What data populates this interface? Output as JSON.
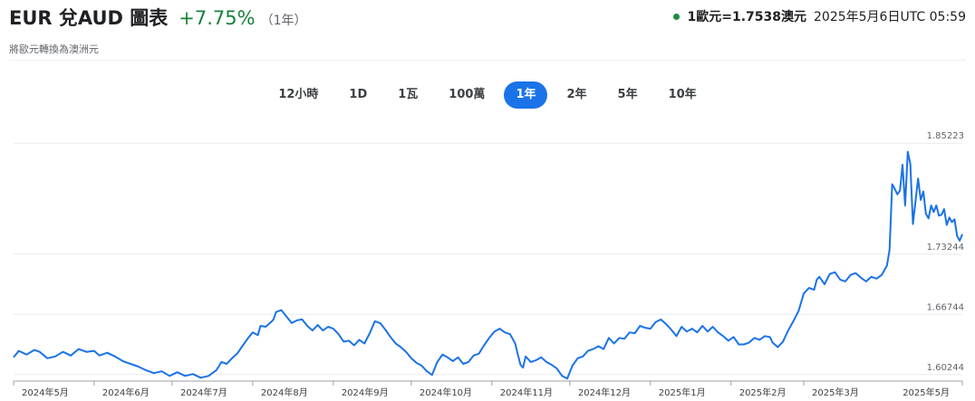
{
  "header": {
    "title": "EUR 兌AUD 圖表",
    "change": "+7.75%",
    "period": "（1年）",
    "subtitle": "將歐元轉換為澳洲元",
    "rate": "1歐元=1.7538澳元",
    "timestamp": "2025年5月6日UTC 05:59"
  },
  "tabs": [
    {
      "label": "12小時",
      "active": false
    },
    {
      "label": "1D",
      "active": false
    },
    {
      "label": "1瓦",
      "active": false
    },
    {
      "label": "100萬",
      "active": false
    },
    {
      "label": "1年",
      "active": true
    },
    {
      "label": "2年",
      "active": false
    },
    {
      "label": "5年",
      "active": false
    },
    {
      "label": "10年",
      "active": false
    }
  ],
  "colors": {
    "line": "#1a73e8",
    "up": "#188038",
    "active_tab": "#1a73e8"
  },
  "chart_data": {
    "type": "line",
    "ylim": [
      1.5954,
      1.8622
    ],
    "yticks": [
      {
        "value": 1.85223,
        "label": "1.85223"
      },
      {
        "value": 1.73244,
        "label": "1.73244"
      },
      {
        "value": 1.66744,
        "label": "1.66744"
      },
      {
        "value": 1.60244,
        "label": "1.60244"
      }
    ],
    "xticks": [
      "2024年5月",
      "2024年6月",
      "2024年7月",
      "2024年8月",
      "2024年9月",
      "2024年10月",
      "2024年11月",
      "2024年12月",
      "2025年1月",
      "2025年2月",
      "2025年3月",
      "2025年5月"
    ],
    "xlim": [
      0,
      365
    ],
    "xtick_positions": [
      0,
      31,
      61,
      92,
      123,
      153,
      184,
      214,
      245,
      276,
      304,
      365
    ],
    "grid": true,
    "series": [
      {
        "points": [
          [
            0,
            1.621
          ],
          [
            2,
            1.628
          ],
          [
            5,
            1.624
          ],
          [
            8,
            1.629
          ],
          [
            10,
            1.627
          ],
          [
            13,
            1.62
          ],
          [
            16,
            1.622
          ],
          [
            19,
            1.627
          ],
          [
            22,
            1.623
          ],
          [
            25,
            1.63
          ],
          [
            28,
            1.627
          ],
          [
            31,
            1.628
          ],
          [
            33,
            1.623
          ],
          [
            36,
            1.626
          ],
          [
            39,
            1.622
          ],
          [
            42,
            1.617
          ],
          [
            45,
            1.614
          ],
          [
            48,
            1.611
          ],
          [
            51,
            1.607
          ],
          [
            54,
            1.604
          ],
          [
            57,
            1.606
          ],
          [
            60,
            1.601
          ],
          [
            63,
            1.605
          ],
          [
            66,
            1.601
          ],
          [
            69,
            1.603
          ],
          [
            72,
            1.599
          ],
          [
            75,
            1.601
          ],
          [
            78,
            1.607
          ],
          [
            80,
            1.616
          ],
          [
            82,
            1.614
          ],
          [
            84,
            1.62
          ],
          [
            86,
            1.625
          ],
          [
            88,
            1.633
          ],
          [
            90,
            1.641
          ],
          [
            92,
            1.648
          ],
          [
            94,
            1.645
          ],
          [
            95,
            1.655
          ],
          [
            97,
            1.654
          ],
          [
            99,
            1.659
          ],
          [
            100,
            1.662
          ],
          [
            101,
            1.67
          ],
          [
            103,
            1.672
          ],
          [
            105,
            1.665
          ],
          [
            107,
            1.658
          ],
          [
            109,
            1.661
          ],
          [
            111,
            1.662
          ],
          [
            113,
            1.655
          ],
          [
            115,
            1.65
          ],
          [
            117,
            1.656
          ],
          [
            119,
            1.65
          ],
          [
            121,
            1.654
          ],
          [
            123,
            1.652
          ],
          [
            125,
            1.646
          ],
          [
            127,
            1.638
          ],
          [
            129,
            1.639
          ],
          [
            131,
            1.634
          ],
          [
            133,
            1.64
          ],
          [
            135,
            1.636
          ],
          [
            137,
            1.647
          ],
          [
            139,
            1.66
          ],
          [
            141,
            1.658
          ],
          [
            143,
            1.651
          ],
          [
            145,
            1.643
          ],
          [
            147,
            1.636
          ],
          [
            149,
            1.632
          ],
          [
            151,
            1.627
          ],
          [
            153,
            1.62
          ],
          [
            155,
            1.615
          ],
          [
            157,
            1.612
          ],
          [
            159,
            1.606
          ],
          [
            161,
            1.602
          ],
          [
            163,
            1.616
          ],
          [
            165,
            1.624
          ],
          [
            167,
            1.621
          ],
          [
            169,
            1.617
          ],
          [
            171,
            1.621
          ],
          [
            173,
            1.614
          ],
          [
            175,
            1.616
          ],
          [
            177,
            1.623
          ],
          [
            179,
            1.625
          ],
          [
            181,
            1.634
          ],
          [
            183,
            1.642
          ],
          [
            185,
            1.649
          ],
          [
            187,
            1.652
          ],
          [
            189,
            1.648
          ],
          [
            191,
            1.646
          ],
          [
            193,
            1.636
          ],
          [
            194,
            1.624
          ],
          [
            195,
            1.613
          ],
          [
            196,
            1.61
          ],
          [
            197,
            1.622
          ],
          [
            199,
            1.616
          ],
          [
            201,
            1.618
          ],
          [
            203,
            1.621
          ],
          [
            205,
            1.616
          ],
          [
            207,
            1.613
          ],
          [
            209,
            1.609
          ],
          [
            211,
            1.601
          ],
          [
            213,
            1.598
          ],
          [
            215,
            1.612
          ],
          [
            217,
            1.62
          ],
          [
            219,
            1.622
          ],
          [
            221,
            1.628
          ],
          [
            223,
            1.63
          ],
          [
            225,
            1.633
          ],
          [
            227,
            1.63
          ],
          [
            229,
            1.642
          ],
          [
            231,
            1.636
          ],
          [
            233,
            1.642
          ],
          [
            235,
            1.641
          ],
          [
            237,
            1.648
          ],
          [
            239,
            1.647
          ],
          [
            241,
            1.655
          ],
          [
            243,
            1.653
          ],
          [
            245,
            1.652
          ],
          [
            247,
            1.659
          ],
          [
            249,
            1.662
          ],
          [
            251,
            1.657
          ],
          [
            253,
            1.651
          ],
          [
            255,
            1.644
          ],
          [
            257,
            1.654
          ],
          [
            259,
            1.649
          ],
          [
            261,
            1.652
          ],
          [
            263,
            1.648
          ],
          [
            265,
            1.655
          ],
          [
            267,
            1.649
          ],
          [
            269,
            1.654
          ],
          [
            271,
            1.648
          ],
          [
            273,
            1.644
          ],
          [
            275,
            1.639
          ],
          [
            277,
            1.643
          ],
          [
            279,
            1.635
          ],
          [
            281,
            1.635
          ],
          [
            283,
            1.637
          ],
          [
            285,
            1.642
          ],
          [
            287,
            1.64
          ],
          [
            289,
            1.644
          ],
          [
            291,
            1.643
          ],
          [
            292,
            1.637
          ],
          [
            294,
            1.632
          ],
          [
            296,
            1.638
          ],
          [
            298,
            1.65
          ],
          [
            300,
            1.66
          ],
          [
            302,
            1.671
          ],
          [
            304,
            1.69
          ],
          [
            306,
            1.696
          ],
          [
            308,
            1.694
          ],
          [
            309,
            1.705
          ],
          [
            310,
            1.708
          ],
          [
            312,
            1.7
          ],
          [
            314,
            1.711
          ],
          [
            316,
            1.713
          ],
          [
            318,
            1.705
          ],
          [
            320,
            1.703
          ],
          [
            322,
            1.71
          ],
          [
            324,
            1.712
          ],
          [
            326,
            1.707
          ],
          [
            328,
            1.703
          ],
          [
            330,
            1.708
          ],
          [
            332,
            1.706
          ],
          [
            334,
            1.71
          ],
          [
            336,
            1.72
          ],
          [
            337,
            1.737
          ],
          [
            338,
            1.808
          ],
          [
            339,
            1.803
          ],
          [
            340,
            1.797
          ],
          [
            341,
            1.801
          ],
          [
            342,
            1.829
          ],
          [
            343,
            1.785
          ],
          [
            344,
            1.843
          ],
          [
            345,
            1.83
          ],
          [
            346,
            1.765
          ],
          [
            347,
            1.79
          ],
          [
            348,
            1.814
          ],
          [
            349,
            1.791
          ],
          [
            350,
            1.8
          ],
          [
            351,
            1.776
          ],
          [
            352,
            1.771
          ],
          [
            353,
            1.785
          ],
          [
            354,
            1.778
          ],
          [
            355,
            1.785
          ],
          [
            356,
            1.774
          ],
          [
            357,
            1.775
          ],
          [
            358,
            1.781
          ],
          [
            359,
            1.764
          ],
          [
            360,
            1.772
          ],
          [
            361,
            1.767
          ],
          [
            362,
            1.77
          ],
          [
            363,
            1.752
          ],
          [
            364,
            1.747
          ],
          [
            365,
            1.754
          ]
        ]
      }
    ]
  }
}
